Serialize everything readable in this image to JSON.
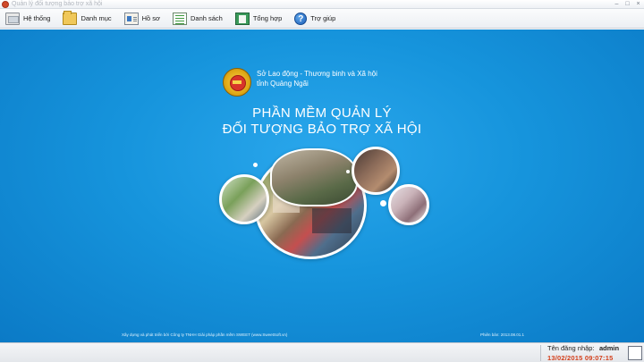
{
  "window": {
    "title": "Quản lý đối tượng bảo trợ xã hội",
    "controls": [
      "–",
      "□",
      "×"
    ]
  },
  "toolbar": {
    "items": [
      {
        "label": "Hệ thống",
        "icon": "computer-icon"
      },
      {
        "label": "Danh mục",
        "icon": "folder-icon"
      },
      {
        "label": "Hồ sơ",
        "icon": "profile-card-icon"
      },
      {
        "label": "Danh sách",
        "icon": "list-icon"
      },
      {
        "label": "Tổng hợp",
        "icon": "report-book-icon"
      },
      {
        "label": "Trợ giúp",
        "icon": "help-icon",
        "glyph": "?"
      }
    ]
  },
  "splash": {
    "org_line1": "Sở Lao động - Thương binh và Xã hội",
    "org_line2": "tỉnh Quảng Ngãi",
    "title_line1": "PHẦN MỀM QUẢN LÝ",
    "title_line2": "ĐỐI TƯỢNG BẢO TRỢ XÃ HỘI",
    "credit": "Xây dựng và phát triển bởi Công ty TNHH Giải pháp phần mềm SWEET (www.SweetSoft.vn)",
    "version": "Phiên bản: 2013.08.01.1",
    "background_color": "#1694dc"
  },
  "status": {
    "login_label": "Tên đăng nhập:",
    "username": "admin",
    "datetime": "13/02/2015 09:07:15",
    "datetime_color": "#d4401c"
  }
}
